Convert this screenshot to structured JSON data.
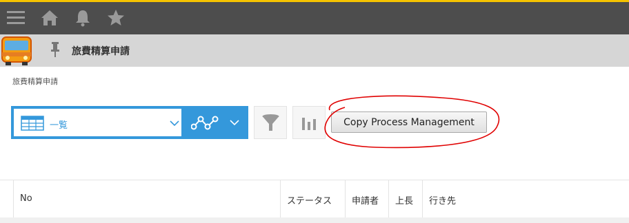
{
  "colors": {
    "accent": "#3498db",
    "topbar": "#4d4d4d",
    "highlight": "#f5c300",
    "annotation": "#e00000"
  },
  "topbar": {
    "icons": [
      "menu-icon",
      "home-icon",
      "bell-icon",
      "star-icon"
    ]
  },
  "app": {
    "title": "旅費精算申請",
    "icon": "bus-icon"
  },
  "breadcrumb": "旅費精算申請",
  "view": {
    "selected": "一覧",
    "icon": "table-icon"
  },
  "toolbar": {
    "graph_icon": "graph-icon",
    "filter_icon": "funnel-icon",
    "chart_icon": "bar-chart-icon",
    "copy_button": "Copy Process Management"
  },
  "table": {
    "columns": [
      "No",
      "ステータス",
      "申請者",
      "上長",
      "行き先"
    ]
  }
}
